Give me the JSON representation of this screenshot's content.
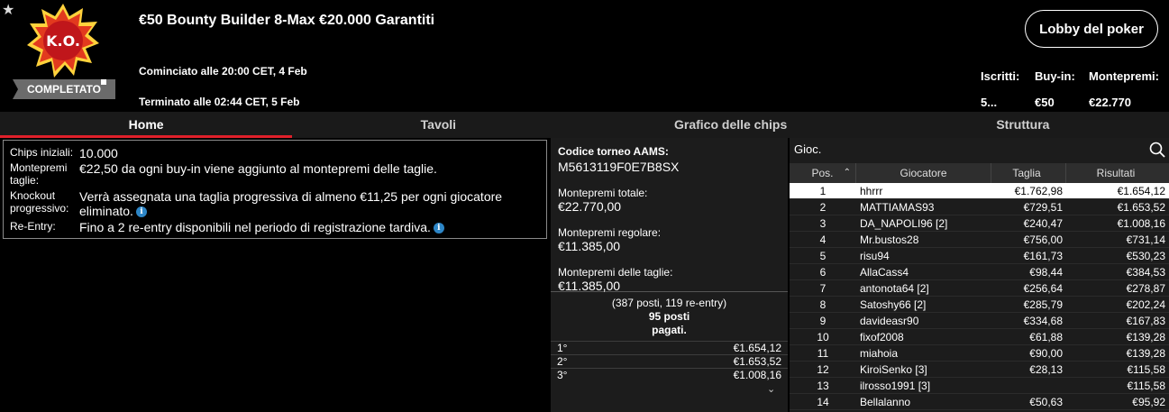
{
  "header": {
    "status": "COMPLETATO",
    "badge_text": "K.O.",
    "title": "€50 Bounty Builder 8-Max €20.000 Garantiti",
    "started": "Cominciato alle 20:00 CET, 4 Feb",
    "ended": "Terminato alle 02:44 CET, 5 Feb",
    "lobby_button": "Lobby del poker",
    "stats": {
      "entrants_label": "Iscritti:",
      "entrants_value": "5...",
      "buyin_label": "Buy-in:",
      "buyin_value": "€50",
      "prizepool_label": "Montepremi:",
      "prizepool_value": "€22.770"
    }
  },
  "tabs": [
    "Home",
    "Tavoli",
    "Grafico delle chips",
    "Struttura"
  ],
  "info": {
    "chips_label": "Chips iniziali:",
    "chips_value": "10.000",
    "bounty_label": "Montepremi taglie:",
    "bounty_value": "€22,50 da ogni buy-in viene aggiunto al montepremi delle taglie.",
    "knockout_label": "Knockout progressivo:",
    "knockout_value": "Verrà assegnata una taglia progressiva di almeno €11,25 per ogni giocatore eliminato.",
    "reentry_label": "Re-Entry:",
    "reentry_value": "Fino a 2 re-entry disponibili nel periodo di registrazione tardiva."
  },
  "middle": {
    "aams_label": "Codice torneo AAMS:",
    "aams_code": "M5613119F0E7B8SX",
    "total_label": "Montepremi totale:",
    "total_value": "€22.770,00",
    "regular_label": "Montepremi regolare:",
    "regular_value": "€11.385,00",
    "bounty_label": "Montepremi delle taglie:",
    "bounty_value": "€11.385,00",
    "posts_line1": "(387 posti, 119 re-entry)",
    "posts_line2": "95 posti",
    "posts_line3": "pagati.",
    "payouts": [
      {
        "place": "1°",
        "amount": "€1.654,12"
      },
      {
        "place": "2°",
        "amount": "€1.653,52"
      },
      {
        "place": "3°",
        "amount": "€1.008,16"
      }
    ]
  },
  "players": {
    "search_label": "Gioc.",
    "columns": [
      "Pos.",
      "Giocatore",
      "Taglia",
      "Risultati"
    ],
    "rows": [
      {
        "pos": "1",
        "name": "hhrrr",
        "bounty": "€1.762,98",
        "result": "€1.654,12"
      },
      {
        "pos": "2",
        "name": "MATTIAMAS93",
        "bounty": "€729,51",
        "result": "€1.653,52"
      },
      {
        "pos": "3",
        "name": "DA_NAPOLI96 [2]",
        "bounty": "€240,47",
        "result": "€1.008,16"
      },
      {
        "pos": "4",
        "name": "Mr.bustos28",
        "bounty": "€756,00",
        "result": "€731,14"
      },
      {
        "pos": "5",
        "name": "risu94",
        "bounty": "€161,73",
        "result": "€530,23"
      },
      {
        "pos": "6",
        "name": "AllaCass4",
        "bounty": "€98,44",
        "result": "€384,53"
      },
      {
        "pos": "7",
        "name": "antonota64 [2]",
        "bounty": "€256,64",
        "result": "€278,87"
      },
      {
        "pos": "8",
        "name": "Satoshy66 [2]",
        "bounty": "€285,79",
        "result": "€202,24"
      },
      {
        "pos": "9",
        "name": "davideasr90",
        "bounty": "€334,68",
        "result": "€167,83"
      },
      {
        "pos": "10",
        "name": "fixof2008",
        "bounty": "€61,88",
        "result": "€139,28"
      },
      {
        "pos": "11",
        "name": "miahoia",
        "bounty": "€90,00",
        "result": "€139,28"
      },
      {
        "pos": "12",
        "name": "KiroiSenko [3]",
        "bounty": "€28,13",
        "result": "€115,58"
      },
      {
        "pos": "13",
        "name": "ilrosso1991 [3]",
        "bounty": "",
        "result": "€115,58"
      },
      {
        "pos": "14",
        "name": "Bellalanno",
        "bounty": "€50,63",
        "result": "€95,92"
      }
    ]
  },
  "colors": {
    "accent_red": "#e0202a",
    "info_blue": "#2d86c7",
    "panel": "#1c1c1c"
  }
}
